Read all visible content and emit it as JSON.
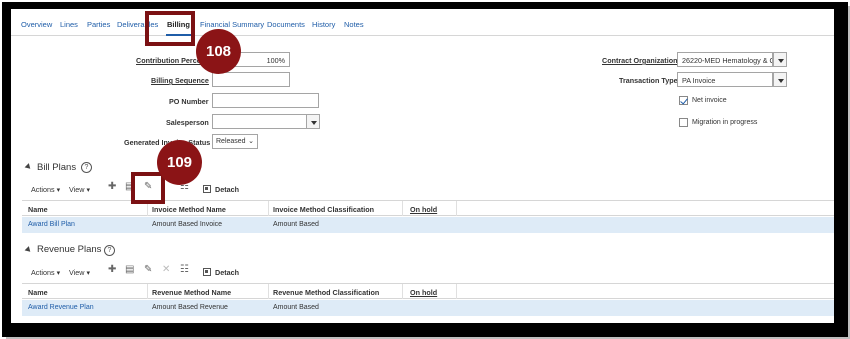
{
  "tabs": [
    {
      "label": "Overview"
    },
    {
      "label": "Lines"
    },
    {
      "label": "Parties"
    },
    {
      "label": "Deliverables"
    },
    {
      "label": "Billing"
    },
    {
      "label": "Financial Summary"
    },
    {
      "label": "Documents"
    },
    {
      "label": "History"
    },
    {
      "label": "Notes"
    }
  ],
  "form": {
    "contribution_percent_label": "Contribution Percent",
    "contribution_percent_value": "100%",
    "billing_sequence_label": "Billing Sequence",
    "billing_sequence_value": "",
    "po_number_label": "PO Number",
    "po_number_value": "",
    "salesperson_label": "Salesperson",
    "salesperson_value": "",
    "generated_invoice_status_label": "Generated Invoice Status",
    "generated_invoice_status_value": "Released",
    "contract_org_label": "Contract Organization",
    "contract_org_value": "26220-MED Hematology & C",
    "transaction_type_label": "Transaction Type",
    "transaction_type_value": "PA Invoice",
    "net_invoice_label": "Net invoice",
    "net_invoice_checked": true,
    "migration_label": "Migration in progress",
    "migration_checked": false
  },
  "bill_plans": {
    "title": "Bill Plans",
    "toolbar": {
      "actions": "Actions",
      "view": "View",
      "detach": "Detach"
    },
    "columns": [
      "Name",
      "Invoice Method Name",
      "Invoice Method Classification",
      "On hold"
    ],
    "rows": [
      {
        "name": "Award Bill Plan",
        "method": "Amount Based Invoice",
        "classification": "Amount Based",
        "on_hold": ""
      }
    ]
  },
  "revenue_plans": {
    "title": "Revenue Plans",
    "toolbar": {
      "actions": "Actions",
      "view": "View",
      "detach": "Detach"
    },
    "columns": [
      "Name",
      "Revenue Method Name",
      "Revenue Method Classification",
      "On hold"
    ],
    "rows": [
      {
        "name": "Award Revenue Plan",
        "method": "Amount Based Revenue",
        "classification": "Amount Based",
        "on_hold": ""
      }
    ]
  },
  "callouts": {
    "first": "108",
    "second": "109"
  },
  "colors": {
    "accent": "#1f5da8",
    "callout": "#8b1416",
    "selected_row": "#deebf7"
  }
}
